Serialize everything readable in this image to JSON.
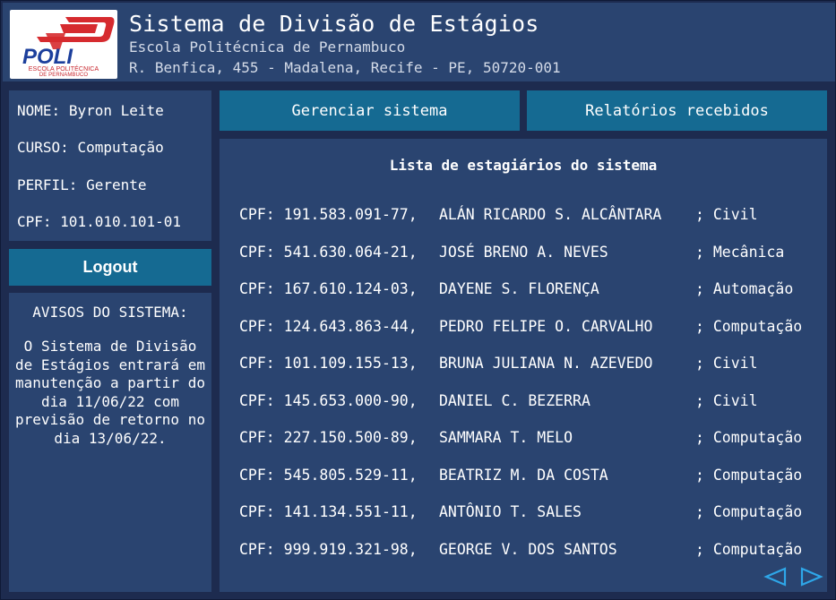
{
  "header": {
    "logo_text": "POLI",
    "logo_sub1": "ESCOLA POLITÉCNICA",
    "logo_sub2": "DE PERNAMBUCO",
    "title": "Sistema de Divisão de Estágios",
    "subtitle": "Escola Politécnica de Pernambuco",
    "address": "R. Benfica, 455 - Madalena, Recife - PE, 50720-001"
  },
  "user": {
    "name_label": "NOME:",
    "name": "Byron Leite",
    "course_label": "CURSO:",
    "course": "Computação",
    "profile_label": "PERFIL:",
    "profile": "Gerente",
    "cpf_label": "CPF:",
    "cpf": "101.010.101-01"
  },
  "logout_label": "Logout",
  "notices": {
    "title": "AVISOS DO SISTEMA:",
    "text": "O Sistema de Divisão de Estágios entrará em manutenção a partir do dia 11/06/22 com previsão de retorno no dia 13/06/22."
  },
  "tabs": {
    "manage": "Gerenciar sistema",
    "reports": "Relatórios recebidos"
  },
  "list": {
    "title": "Lista de estagiários do sistema",
    "rows": [
      {
        "cpf": "CPF: 191.583.091-77,",
        "name": "ALÁN RICARDO S. ALCÂNTARA",
        "course": "; Civil"
      },
      {
        "cpf": "CPF: 541.630.064-21,",
        "name": "JOSÉ BRENO A. NEVES",
        "course": "; Mecânica"
      },
      {
        "cpf": "CPF: 167.610.124-03,",
        "name": "DAYENE S. FLORENÇA",
        "course": "; Automação"
      },
      {
        "cpf": "CPF: 124.643.863-44,",
        "name": "PEDRO FELIPE O. CARVALHO",
        "course": "; Computação"
      },
      {
        "cpf": "CPF: 101.109.155-13,",
        "name": "BRUNA JULIANA N. AZEVEDO",
        "course": "; Civil"
      },
      {
        "cpf": "CPF: 145.653.000-90,",
        "name": "DANIEL C. BEZERRA",
        "course": "; Civil"
      },
      {
        "cpf": "CPF: 227.150.500-89,",
        "name": "SAMMARA T. MELO",
        "course": "; Computação"
      },
      {
        "cpf": "CPF: 545.805.529-11,",
        "name": "BEATRIZ M. DA COSTA",
        "course": "; Computação"
      },
      {
        "cpf": "CPF: 141.134.551-11,",
        "name": "ANTÔNIO T. SALES",
        "course": "; Computação"
      },
      {
        "cpf": "CPF: 999.919.321-98,",
        "name": "GEORGE V. DOS SANTOS",
        "course": "; Computação"
      }
    ]
  },
  "pagination": {
    "prev_icon": "triangle-left-outline-icon",
    "next_icon": "triangle-right-outline-icon"
  },
  "colors": {
    "background": "#1d2b4f",
    "panel": "#2a4470",
    "button": "#156a92",
    "nav_arrow": "#2ea6e8",
    "logo_red": "#d62b2f",
    "logo_blue": "#1c3f9c"
  }
}
